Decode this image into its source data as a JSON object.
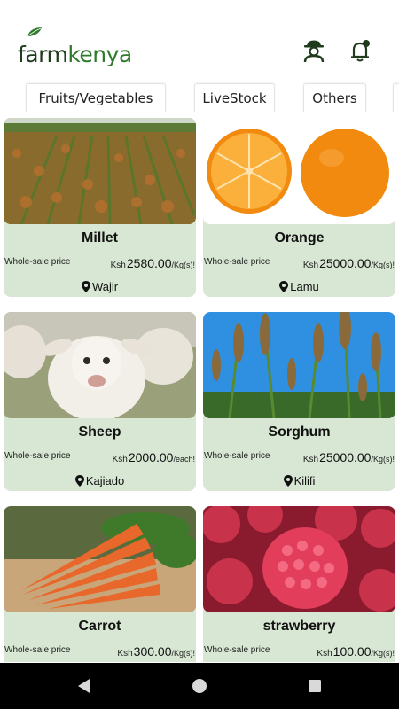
{
  "app": {
    "logo_part1": "farm",
    "logo_part2": "kenya"
  },
  "header": {
    "profile_icon": "farmer-icon",
    "notification_icon": "bell-icon"
  },
  "tabs": [
    {
      "label": "Fruits/Vegetables"
    },
    {
      "label": "LiveStock"
    },
    {
      "label": "Others"
    }
  ],
  "products": [
    {
      "name": "Millet",
      "price_label": "Whole-sale price",
      "currency": "Ksh",
      "price": "2580.00",
      "unit": "/Kg(s)!",
      "location": "Wajir"
    },
    {
      "name": "Orange",
      "price_label": "Whole-sale price",
      "currency": "Ksh",
      "price": "25000.00",
      "unit": "/Kg(s)!",
      "location": "Lamu"
    },
    {
      "name": "Sheep",
      "price_label": "Whole-sale price",
      "currency": "Ksh",
      "price": "2000.00",
      "unit": "/each!",
      "location": "Kajiado"
    },
    {
      "name": "Sorghum",
      "price_label": "Whole-sale price",
      "currency": "Ksh",
      "price": "25000.00",
      "unit": "/Kg(s)!",
      "location": "Kilifi"
    },
    {
      "name": "Carrot",
      "price_label": "Whole-sale price",
      "currency": "Ksh",
      "price": "300.00",
      "unit": "/Kg(s)!",
      "location": ""
    },
    {
      "name": "strawberry",
      "price_label": "Whole-sale price",
      "currency": "Ksh",
      "price": "100.00",
      "unit": "/Kg(s)!",
      "location": ""
    }
  ],
  "colors": {
    "brand_dark": "#1f3b1c",
    "brand_green": "#2f7a2b",
    "card_bg": "#d7e7d3",
    "navbar": "#000000"
  },
  "system_nav": {
    "back_icon": "back-triangle-icon",
    "home_icon": "home-circle-icon",
    "recent_icon": "recents-square-icon"
  }
}
